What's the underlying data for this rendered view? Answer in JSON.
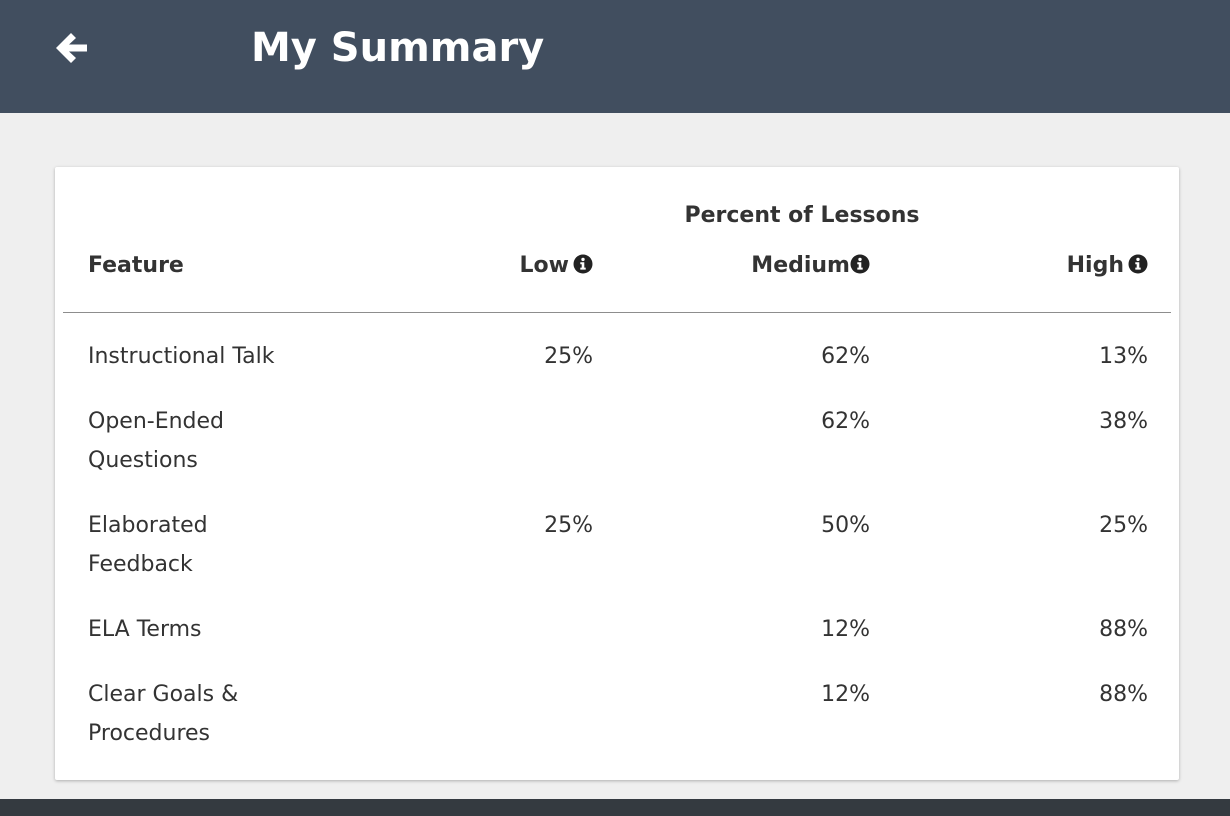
{
  "header": {
    "title": "My Summary",
    "back_icon": "arrow-left-icon"
  },
  "table": {
    "group_header": "Percent of Lessons",
    "columns": {
      "feature": "Feature",
      "low": "Low",
      "medium": "Medium",
      "high": "High"
    },
    "info_icon": "info-circle-icon",
    "rows": [
      {
        "feature": "Instructional Talk",
        "low": "25%",
        "medium": "62%",
        "high": "13%"
      },
      {
        "feature": "Open-Ended Questions",
        "low": "",
        "medium": "62%",
        "high": "38%"
      },
      {
        "feature": "Elaborated Feedback",
        "low": "25%",
        "medium": "50%",
        "high": "25%"
      },
      {
        "feature": "ELA Terms",
        "low": "",
        "medium": "12%",
        "high": "88%"
      },
      {
        "feature": "Clear Goals & Procedures",
        "low": "",
        "medium": "12%",
        "high": "88%"
      }
    ]
  },
  "colors": {
    "header_bg": "#414e5f",
    "page_bg": "#efefef",
    "card_bg": "#ffffff",
    "footer_bg": "#343a40"
  }
}
